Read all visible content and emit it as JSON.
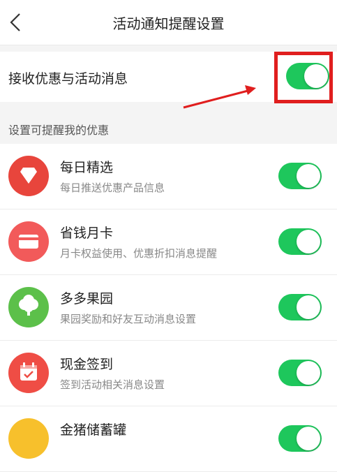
{
  "header": {
    "title": "活动通知提醒设置"
  },
  "main_setting": {
    "label": "接收优惠与活动消息",
    "enabled": true
  },
  "section": {
    "title": "设置可提醒我的优惠"
  },
  "items": [
    {
      "name": "每日精选",
      "desc": "每日推送优惠产品信息",
      "icon": "diamond-icon",
      "icon_color": "#e8453c",
      "enabled": true
    },
    {
      "name": "省钱月卡",
      "desc": "月卡权益使用、优惠折扣消息提醒",
      "icon": "card-icon",
      "icon_color": "#f25a5a",
      "enabled": true
    },
    {
      "name": "多多果园",
      "desc": "果园奖励和好友互动消息设置",
      "icon": "tree-icon",
      "icon_color": "#5cc04a",
      "enabled": true
    },
    {
      "name": "现金签到",
      "desc": "签到活动相关消息设置",
      "icon": "calendar-check-icon",
      "icon_color": "#ef4d45",
      "enabled": true
    },
    {
      "name": "金猪储蓄罐",
      "desc": "",
      "icon": "piggy-bank-icon",
      "icon_color": "#f7c02c",
      "enabled": true
    }
  ],
  "colors": {
    "toggle_on": "#1ec75c",
    "highlight": "#e01e1e"
  }
}
